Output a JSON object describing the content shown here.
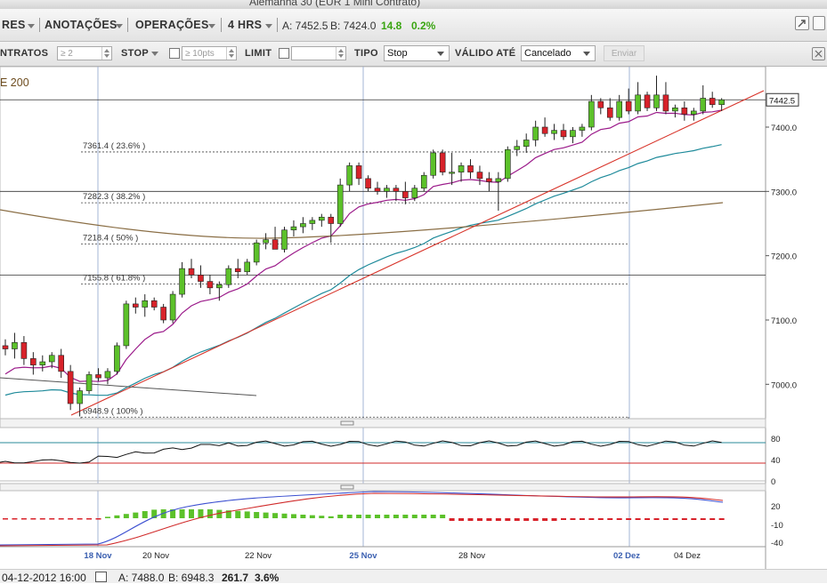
{
  "window": {
    "title": "Alemanha 30 (EUR 1 Mini Contrato)"
  },
  "menubar": {
    "item_res": "RES",
    "item_anotacoes": "ANOTAÇÕES",
    "item_operacoes": "OPERAÇÕES",
    "item_timeframe": "4 HRS",
    "quote_ask": "A: 7452.5",
    "quote_bid": "B: 7424.0",
    "quote_change": "14.8",
    "quote_change_pct": "0.2%"
  },
  "orderbar": {
    "contracts_label": "NTRATOS",
    "contracts_value": "≥ 2",
    "stop_label": "STOP",
    "stop_value": "≥ 10pts",
    "limit_label": "LIMIT",
    "tipo_label": "TIPO",
    "tipo_value": "Stop",
    "valido_label": "VÁLIDO ATÉ",
    "valido_value": "Cancelado",
    "enviar_label": "Enviar"
  },
  "chart": {
    "indicator_label": "E 200",
    "current_price_label": "7442.5",
    "price_ticks": [
      "7400.0",
      "7300.0",
      "7200.0",
      "7100.0",
      "7000.0"
    ],
    "rsi_ticks": [
      "80",
      "40",
      "0"
    ],
    "macd_ticks": [
      "20",
      "-10",
      "-40"
    ],
    "date_ticks": [
      {
        "label": "18 Nov",
        "highlight": true
      },
      {
        "label": "20 Nov",
        "highlight": false
      },
      {
        "label": "22 Nov",
        "highlight": false
      },
      {
        "label": "25 Nov",
        "highlight": true
      },
      {
        "label": "28 Nov",
        "highlight": false
      },
      {
        "label": "02 Dez",
        "highlight": true
      },
      {
        "label": "04 Dez",
        "highlight": false
      }
    ],
    "fib_labels": [
      "7361.4 ( 23.6% )",
      "7282.3 ( 38.2% )",
      "7218.4 ( 50% )",
      "7155.8 ( 61.8% )",
      "6948.9 ( 100% )"
    ],
    "colors": {
      "up": "#5cc12a",
      "down": "#d8222a",
      "ma_short": "#9b1a8a",
      "ma_mid": "#1e8a9a",
      "ma_long": "#8a6e45",
      "trendline": "#d8342a"
    }
  },
  "chart_data": {
    "type": "candlestick",
    "candles": [
      [
        7060,
        7070,
        7045,
        7055
      ],
      [
        7055,
        7080,
        7040,
        7065
      ],
      [
        7065,
        7075,
        7030,
        7040
      ],
      [
        7040,
        7050,
        7015,
        7030
      ],
      [
        7030,
        7045,
        7020,
        7035
      ],
      [
        7035,
        7050,
        7025,
        7045
      ],
      [
        7045,
        7055,
        7010,
        7020
      ],
      [
        7020,
        7030,
        6960,
        6970
      ],
      [
        6970,
        6995,
        6950,
        6990
      ],
      [
        6990,
        7020,
        6985,
        7015
      ],
      [
        7015,
        7025,
        7005,
        7010
      ],
      [
        7010,
        7025,
        7000,
        7020
      ],
      [
        7020,
        7065,
        7015,
        7060
      ],
      [
        7060,
        7130,
        7055,
        7125
      ],
      [
        7125,
        7135,
        7110,
        7120
      ],
      [
        7120,
        7140,
        7105,
        7130
      ],
      [
        7130,
        7135,
        7115,
        7120
      ],
      [
        7120,
        7125,
        7095,
        7100
      ],
      [
        7100,
        7145,
        7095,
        7140
      ],
      [
        7140,
        7190,
        7135,
        7180
      ],
      [
        7180,
        7195,
        7165,
        7170
      ],
      [
        7170,
        7185,
        7150,
        7160
      ],
      [
        7160,
        7170,
        7140,
        7150
      ],
      [
        7150,
        7160,
        7130,
        7155
      ],
      [
        7155,
        7185,
        7150,
        7180
      ],
      [
        7180,
        7195,
        7165,
        7175
      ],
      [
        7175,
        7195,
        7170,
        7190
      ],
      [
        7190,
        7225,
        7185,
        7220
      ],
      [
        7220,
        7235,
        7210,
        7225
      ],
      [
        7225,
        7245,
        7220,
        7210
      ],
      [
        7210,
        7245,
        7205,
        7240
      ],
      [
        7240,
        7255,
        7230,
        7245
      ],
      [
        7245,
        7260,
        7235,
        7250
      ],
      [
        7250,
        7260,
        7240,
        7255
      ],
      [
        7255,
        7265,
        7245,
        7260
      ],
      [
        7260,
        7265,
        7220,
        7250
      ],
      [
        7250,
        7320,
        7245,
        7310
      ],
      [
        7310,
        7345,
        7300,
        7340
      ],
      [
        7340,
        7345,
        7310,
        7320
      ],
      [
        7320,
        7325,
        7300,
        7305
      ],
      [
        7305,
        7315,
        7295,
        7300
      ],
      [
        7300,
        7310,
        7290,
        7305
      ],
      [
        7305,
        7310,
        7285,
        7300
      ],
      [
        7300,
        7315,
        7280,
        7290
      ],
      [
        7290,
        7310,
        7285,
        7305
      ],
      [
        7305,
        7330,
        7300,
        7325
      ],
      [
        7325,
        7365,
        7320,
        7360
      ],
      [
        7360,
        7365,
        7325,
        7330
      ],
      [
        7330,
        7360,
        7310,
        7330
      ],
      [
        7330,
        7345,
        7315,
        7340
      ],
      [
        7340,
        7350,
        7320,
        7330
      ],
      [
        7330,
        7340,
        7310,
        7320
      ],
      [
        7320,
        7330,
        7300,
        7315
      ],
      [
        7315,
        7330,
        7270,
        7320
      ],
      [
        7320,
        7370,
        7315,
        7365
      ],
      [
        7365,
        7380,
        7355,
        7370
      ],
      [
        7370,
        7390,
        7360,
        7380
      ],
      [
        7380,
        7410,
        7370,
        7400
      ],
      [
        7400,
        7415,
        7385,
        7390
      ],
      [
        7390,
        7405,
        7380,
        7395
      ],
      [
        7395,
        7405,
        7380,
        7385
      ],
      [
        7385,
        7400,
        7375,
        7395
      ],
      [
        7395,
        7405,
        7385,
        7400
      ],
      [
        7400,
        7450,
        7395,
        7440
      ],
      [
        7440,
        7445,
        7420,
        7430
      ],
      [
        7430,
        7445,
        7410,
        7415
      ],
      [
        7415,
        7450,
        7410,
        7440
      ],
      [
        7440,
        7460,
        7420,
        7425
      ],
      [
        7425,
        7470,
        7420,
        7450
      ],
      [
        7450,
        7455,
        7425,
        7430
      ],
      [
        7430,
        7480,
        7425,
        7450
      ],
      [
        7450,
        7470,
        7420,
        7425
      ],
      [
        7425,
        7435,
        7415,
        7430
      ],
      [
        7430,
        7440,
        7410,
        7420
      ],
      [
        7420,
        7430,
        7410,
        7425
      ],
      [
        7425,
        7465,
        7420,
        7445
      ],
      [
        7445,
        7455,
        7430,
        7435
      ],
      [
        7435,
        7445,
        7425,
        7442.5
      ]
    ]
  },
  "statusbar": {
    "datetime": "04-12-2012 16:00",
    "ask": "A: 7488.0",
    "bid": "B: 6948.3",
    "change": "261.7",
    "change_pct": "3.6%"
  }
}
